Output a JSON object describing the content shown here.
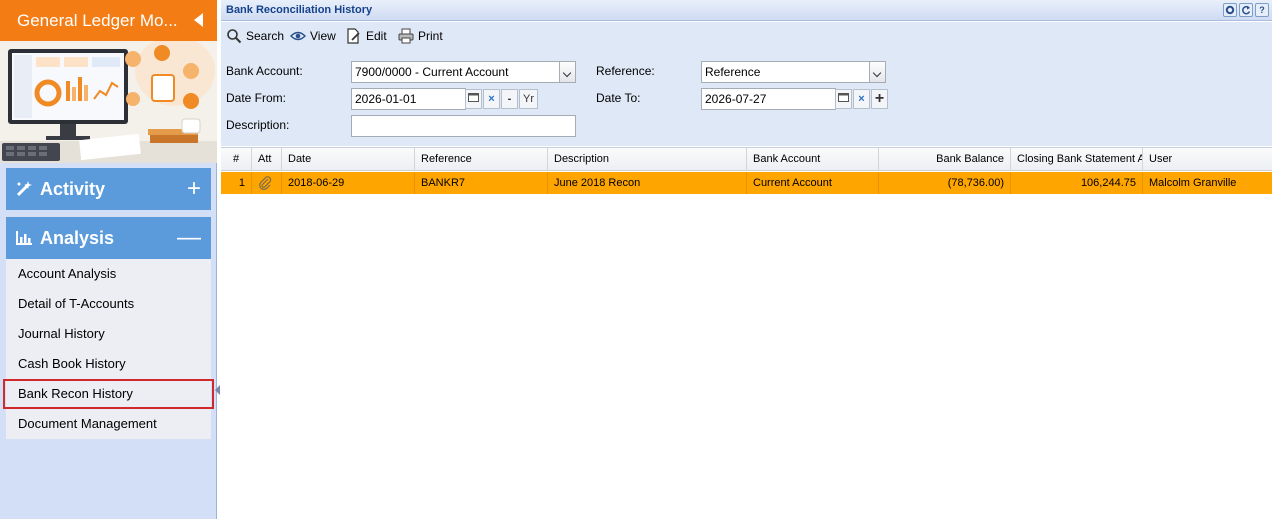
{
  "sidebar": {
    "header_title": "General Ledger Mo...",
    "accordions": [
      {
        "label": "Activity",
        "toggle": "+"
      },
      {
        "label": "Analysis",
        "toggle": "—"
      }
    ],
    "items": [
      {
        "label": "Account Analysis"
      },
      {
        "label": "Detail of T-Accounts"
      },
      {
        "label": "Journal History"
      },
      {
        "label": "Cash Book History"
      },
      {
        "label": "Bank Recon History"
      },
      {
        "label": "Document Management"
      }
    ],
    "selected_item": "Bank Recon History"
  },
  "panel": {
    "title": "Bank Reconciliation History",
    "title_buttons": [
      "gear-icon",
      "refresh-icon",
      "help-icon"
    ],
    "help_label": "?"
  },
  "toolbar": {
    "search_label": "Search",
    "view_label": "View",
    "edit_label": "Edit",
    "print_label": "Print"
  },
  "form": {
    "bank_account_label": "Bank Account:",
    "bank_account_value": "7900/0000 - Current Account",
    "reference_label": "Reference:",
    "reference_value": "Reference",
    "date_from_label": "Date From:",
    "date_from_value": "2026-01-01",
    "date_to_label": "Date To:",
    "date_to_value": "2026-07-27",
    "description_label": "Description:",
    "description_value": "",
    "minus_label": "-",
    "year_label": "Yr",
    "clear_label": "×",
    "plus_label": "+"
  },
  "grid": {
    "columns": [
      "#",
      "Att",
      "Date",
      "Reference",
      "Description",
      "Bank Account",
      "Bank Balance",
      "Closing Bank Statement A",
      "User"
    ],
    "rows": [
      {
        "num": "1",
        "date": "2018-06-29",
        "reference": "BANKR7",
        "description": "June 2018 Recon",
        "bank_account": "Current Account",
        "bank_balance": "(78,736.00)",
        "closing_balance": "106,244.75",
        "user": "Malcolm Granville"
      }
    ]
  },
  "colors": {
    "header_orange": "#f47c14",
    "accordion_blue": "#5b9bdc",
    "selected_row": "#ffa500",
    "selected_outline": "#d12a2a",
    "panel_bg": "#dfe8f6",
    "title_text": "#15428b"
  }
}
